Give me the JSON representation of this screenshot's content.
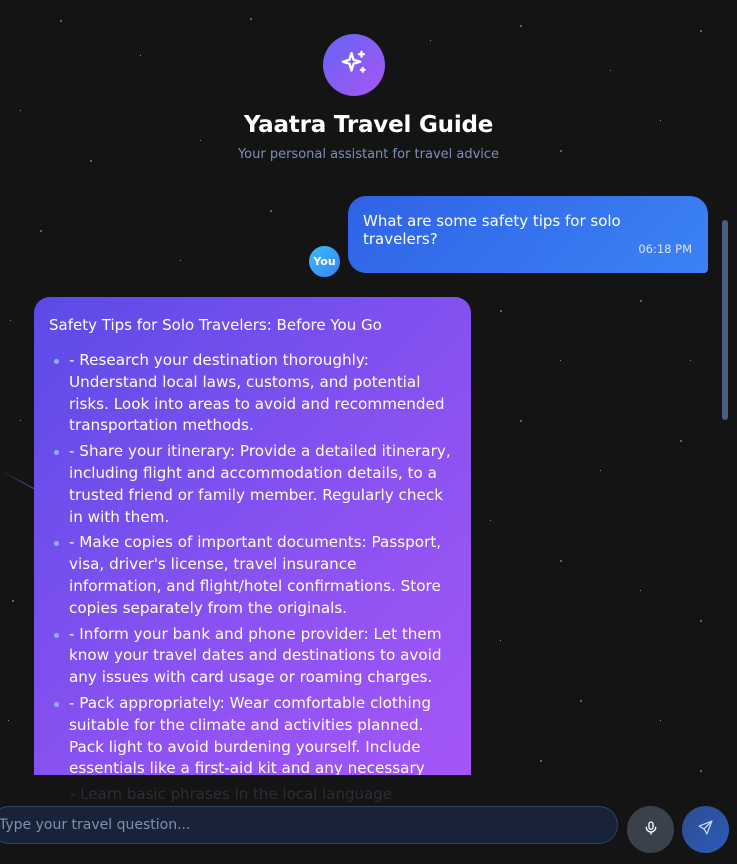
{
  "header": {
    "title": "Yaatra Travel Guide",
    "subtitle": "Your personal assistant for travel advice",
    "logo_icon": "sparkles-icon"
  },
  "colors": {
    "accent_gradient_start": "#6366f1",
    "accent_gradient_end": "#a855f7",
    "user_bubble": "#3b82f6",
    "background": "#141414"
  },
  "messages": {
    "user": {
      "text": "What are some safety tips for solo travelers?",
      "time": "06:18 PM",
      "avatar_label": "You"
    },
    "assistant": {
      "heading": "Safety Tips for Solo Travelers: Before You Go",
      "tips": [
        "- Research your destination thoroughly: Understand local laws, customs, and potential risks. Look into areas to avoid and recommended transportation methods.",
        "- Share your itinerary: Provide a detailed itinerary, including flight and accommodation details, to a trusted friend or family member. Regularly check in with them.",
        "- Make copies of important documents: Passport, visa, driver's license, travel insurance information, and flight/hotel confirmations. Store copies separately from the originals.",
        "- Inform your bank and phone provider: Let them know your travel dates and destinations to avoid any issues with card usage or roaming charges.",
        "- Pack appropriately: Wear comfortable clothing suitable for the climate and activities planned. Pack light to avoid burdening yourself. Include essentials like a first-aid kit and any necessary medications."
      ],
      "partial_next": "- Learn basic phrases in the local language"
    }
  },
  "composer": {
    "placeholder": "Type your travel question...",
    "mic_icon": "microphone-icon",
    "send_icon": "send-icon"
  }
}
